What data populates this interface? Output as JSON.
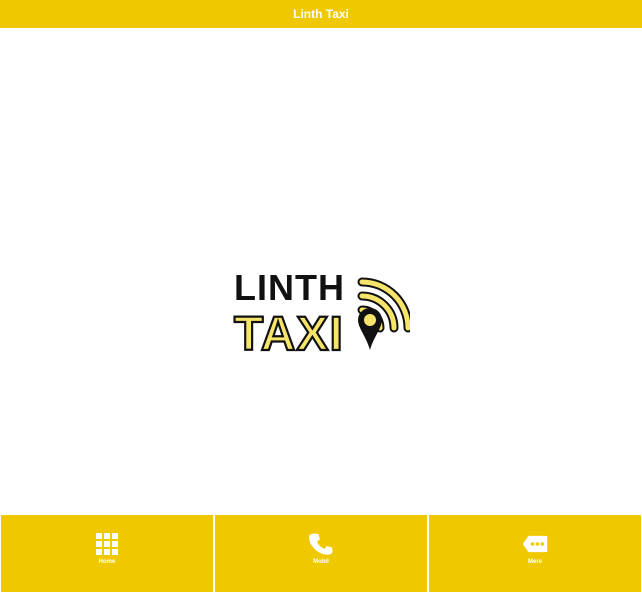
{
  "header": {
    "title": "Linth Taxi"
  },
  "logo": {
    "line1": "LINTH",
    "line2": "TAXI"
  },
  "colors": {
    "accent": "#f0c800",
    "logo_yellow": "#f7e46a",
    "logo_dark": "#111111"
  },
  "tabs": [
    {
      "label": "Home",
      "icon": "grid-icon"
    },
    {
      "label": "Mobil",
      "icon": "phone-icon"
    },
    {
      "label": "Mere",
      "icon": "more-tag-icon"
    }
  ]
}
